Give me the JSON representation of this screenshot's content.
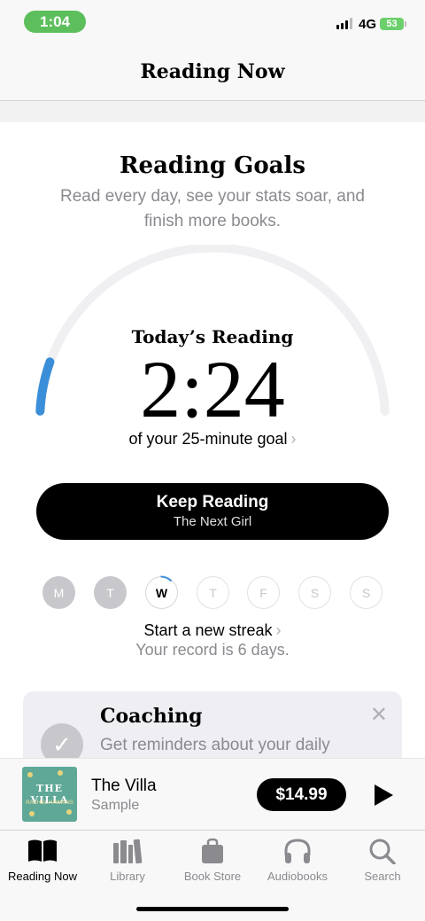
{
  "status": {
    "time": "1:04",
    "network": "4G",
    "battery": "53"
  },
  "nav": {
    "title": "Reading Now"
  },
  "goals": {
    "title": "Reading Goals",
    "subtitle": "Read every day, see your stats soar, and finish more books.",
    "today_label": "Today’s Reading",
    "today_time": "2:24",
    "goal_text": "of your 25-minute goal",
    "goal_progress": 0.096
  },
  "keep_reading": {
    "label": "Keep Reading",
    "book": "The Next Girl"
  },
  "week": [
    {
      "letter": "M",
      "state": "done"
    },
    {
      "letter": "T",
      "state": "done"
    },
    {
      "letter": "W",
      "state": "today"
    },
    {
      "letter": "T",
      "state": "future"
    },
    {
      "letter": "F",
      "state": "future"
    },
    {
      "letter": "S",
      "state": "future"
    },
    {
      "letter": "S",
      "state": "future"
    }
  ],
  "streak": {
    "label": "Start a new streak",
    "record": "Your record is 6 days."
  },
  "coaching": {
    "title": "Coaching",
    "text": "Get reminders about your daily"
  },
  "mini_player": {
    "book_title": "The Villa",
    "book_sub": "Sample",
    "price": "$14.99",
    "cover_title": "THE VILLA",
    "cover_author": "RACHEL HAWKINS"
  },
  "tabs": [
    {
      "label": "Reading Now",
      "icon": "book-open-icon",
      "active": true
    },
    {
      "label": "Library",
      "icon": "library-books-icon",
      "active": false
    },
    {
      "label": "Book Store",
      "icon": "shopping-bag-icon",
      "active": false
    },
    {
      "label": "Audiobooks",
      "icon": "headphones-icon",
      "active": false
    },
    {
      "label": "Search",
      "icon": "search-icon",
      "active": false
    }
  ],
  "colors": {
    "progress": "#3b8fd9",
    "track": "#f0f0f3",
    "accent": "#000000"
  }
}
